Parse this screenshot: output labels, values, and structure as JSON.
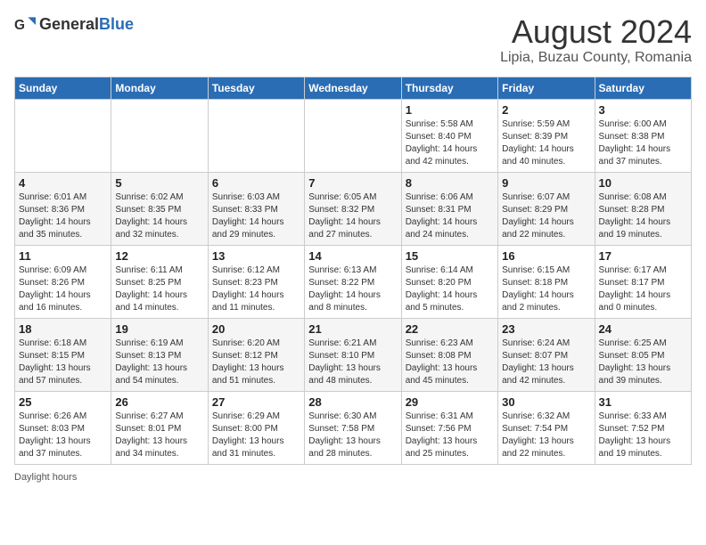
{
  "header": {
    "logo_general": "General",
    "logo_blue": "Blue",
    "title": "August 2024",
    "subtitle": "Lipia, Buzau County, Romania"
  },
  "calendar": {
    "days_of_week": [
      "Sunday",
      "Monday",
      "Tuesday",
      "Wednesday",
      "Thursday",
      "Friday",
      "Saturday"
    ],
    "weeks": [
      [
        {
          "day": "",
          "info": ""
        },
        {
          "day": "",
          "info": ""
        },
        {
          "day": "",
          "info": ""
        },
        {
          "day": "",
          "info": ""
        },
        {
          "day": "1",
          "info": "Sunrise: 5:58 AM\nSunset: 8:40 PM\nDaylight: 14 hours and 42 minutes."
        },
        {
          "day": "2",
          "info": "Sunrise: 5:59 AM\nSunset: 8:39 PM\nDaylight: 14 hours and 40 minutes."
        },
        {
          "day": "3",
          "info": "Sunrise: 6:00 AM\nSunset: 8:38 PM\nDaylight: 14 hours and 37 minutes."
        }
      ],
      [
        {
          "day": "4",
          "info": "Sunrise: 6:01 AM\nSunset: 8:36 PM\nDaylight: 14 hours and 35 minutes."
        },
        {
          "day": "5",
          "info": "Sunrise: 6:02 AM\nSunset: 8:35 PM\nDaylight: 14 hours and 32 minutes."
        },
        {
          "day": "6",
          "info": "Sunrise: 6:03 AM\nSunset: 8:33 PM\nDaylight: 14 hours and 29 minutes."
        },
        {
          "day": "7",
          "info": "Sunrise: 6:05 AM\nSunset: 8:32 PM\nDaylight: 14 hours and 27 minutes."
        },
        {
          "day": "8",
          "info": "Sunrise: 6:06 AM\nSunset: 8:31 PM\nDaylight: 14 hours and 24 minutes."
        },
        {
          "day": "9",
          "info": "Sunrise: 6:07 AM\nSunset: 8:29 PM\nDaylight: 14 hours and 22 minutes."
        },
        {
          "day": "10",
          "info": "Sunrise: 6:08 AM\nSunset: 8:28 PM\nDaylight: 14 hours and 19 minutes."
        }
      ],
      [
        {
          "day": "11",
          "info": "Sunrise: 6:09 AM\nSunset: 8:26 PM\nDaylight: 14 hours and 16 minutes."
        },
        {
          "day": "12",
          "info": "Sunrise: 6:11 AM\nSunset: 8:25 PM\nDaylight: 14 hours and 14 minutes."
        },
        {
          "day": "13",
          "info": "Sunrise: 6:12 AM\nSunset: 8:23 PM\nDaylight: 14 hours and 11 minutes."
        },
        {
          "day": "14",
          "info": "Sunrise: 6:13 AM\nSunset: 8:22 PM\nDaylight: 14 hours and 8 minutes."
        },
        {
          "day": "15",
          "info": "Sunrise: 6:14 AM\nSunset: 8:20 PM\nDaylight: 14 hours and 5 minutes."
        },
        {
          "day": "16",
          "info": "Sunrise: 6:15 AM\nSunset: 8:18 PM\nDaylight: 14 hours and 2 minutes."
        },
        {
          "day": "17",
          "info": "Sunrise: 6:17 AM\nSunset: 8:17 PM\nDaylight: 14 hours and 0 minutes."
        }
      ],
      [
        {
          "day": "18",
          "info": "Sunrise: 6:18 AM\nSunset: 8:15 PM\nDaylight: 13 hours and 57 minutes."
        },
        {
          "day": "19",
          "info": "Sunrise: 6:19 AM\nSunset: 8:13 PM\nDaylight: 13 hours and 54 minutes."
        },
        {
          "day": "20",
          "info": "Sunrise: 6:20 AM\nSunset: 8:12 PM\nDaylight: 13 hours and 51 minutes."
        },
        {
          "day": "21",
          "info": "Sunrise: 6:21 AM\nSunset: 8:10 PM\nDaylight: 13 hours and 48 minutes."
        },
        {
          "day": "22",
          "info": "Sunrise: 6:23 AM\nSunset: 8:08 PM\nDaylight: 13 hours and 45 minutes."
        },
        {
          "day": "23",
          "info": "Sunrise: 6:24 AM\nSunset: 8:07 PM\nDaylight: 13 hours and 42 minutes."
        },
        {
          "day": "24",
          "info": "Sunrise: 6:25 AM\nSunset: 8:05 PM\nDaylight: 13 hours and 39 minutes."
        }
      ],
      [
        {
          "day": "25",
          "info": "Sunrise: 6:26 AM\nSunset: 8:03 PM\nDaylight: 13 hours and 37 minutes."
        },
        {
          "day": "26",
          "info": "Sunrise: 6:27 AM\nSunset: 8:01 PM\nDaylight: 13 hours and 34 minutes."
        },
        {
          "day": "27",
          "info": "Sunrise: 6:29 AM\nSunset: 8:00 PM\nDaylight: 13 hours and 31 minutes."
        },
        {
          "day": "28",
          "info": "Sunrise: 6:30 AM\nSunset: 7:58 PM\nDaylight: 13 hours and 28 minutes."
        },
        {
          "day": "29",
          "info": "Sunrise: 6:31 AM\nSunset: 7:56 PM\nDaylight: 13 hours and 25 minutes."
        },
        {
          "day": "30",
          "info": "Sunrise: 6:32 AM\nSunset: 7:54 PM\nDaylight: 13 hours and 22 minutes."
        },
        {
          "day": "31",
          "info": "Sunrise: 6:33 AM\nSunset: 7:52 PM\nDaylight: 13 hours and 19 minutes."
        }
      ]
    ]
  },
  "footer": {
    "note": "Daylight hours"
  }
}
